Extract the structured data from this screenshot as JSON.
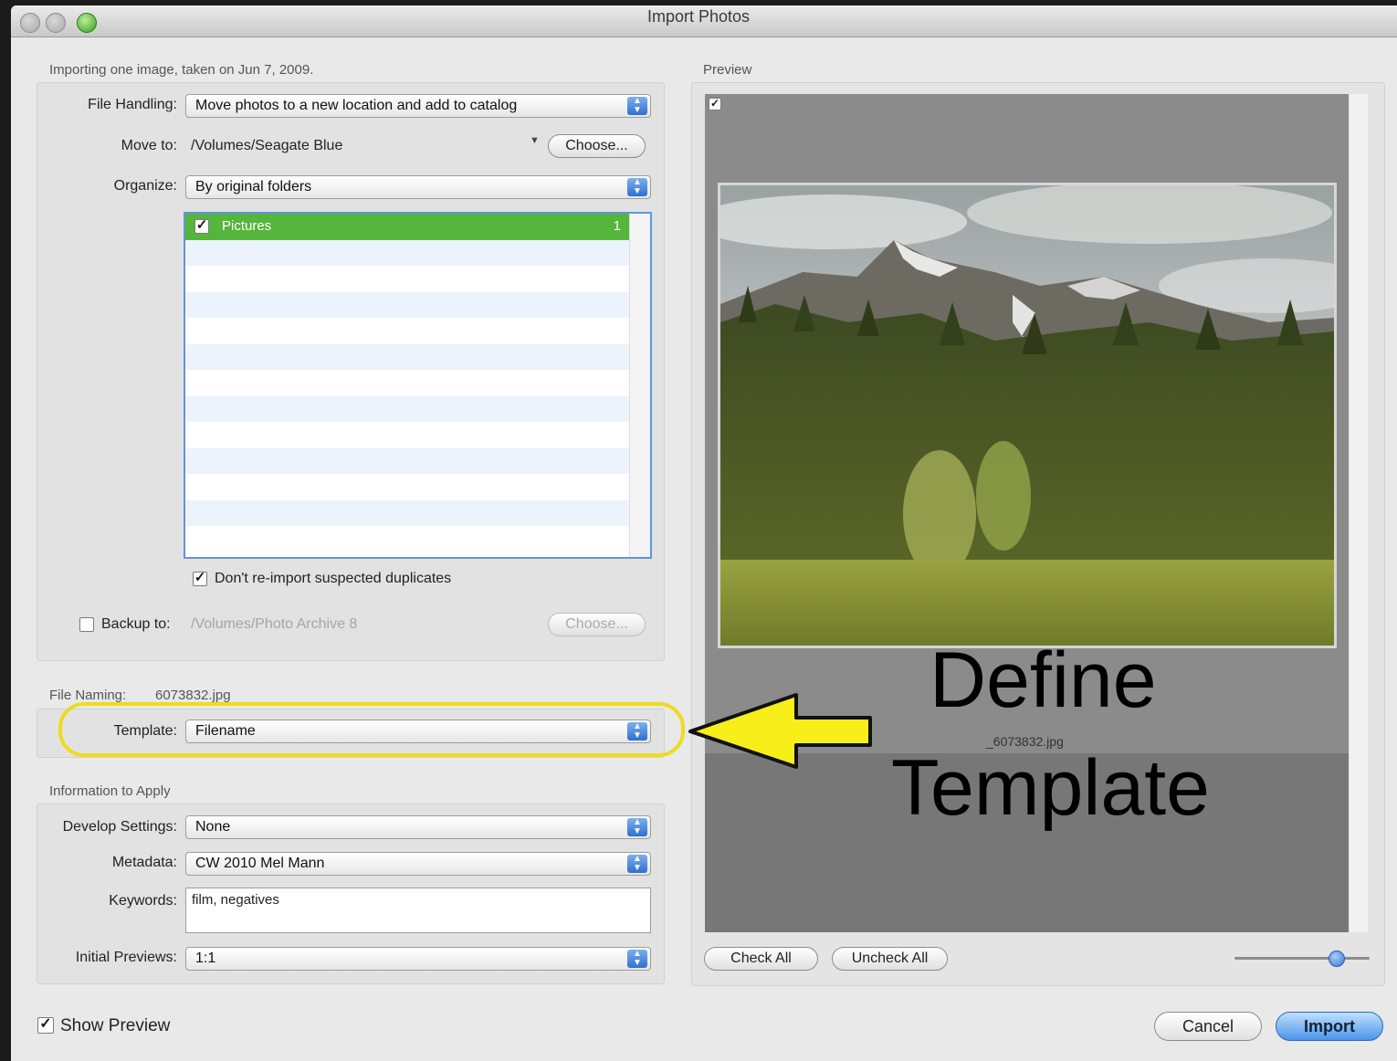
{
  "window": {
    "title": "Import Photos"
  },
  "summary": "Importing one image, taken on Jun 7, 2009.",
  "file_handling": {
    "label": "File Handling:",
    "value": "Move photos to a new location and add to catalog",
    "move_to_label": "Move to:",
    "move_to_path": "/Volumes/Seagate Blue",
    "choose_label": "Choose...",
    "organize_label": "Organize:",
    "organize_value": "By original folders",
    "folders": [
      {
        "name": "Pictures",
        "count": "1",
        "checked": true
      }
    ],
    "dont_reimport_label": "Don't re-import suspected duplicates",
    "backup_label": "Backup to:",
    "backup_path": "/Volumes/Photo Archive 8",
    "backup_choose_label": "Choose..."
  },
  "file_naming": {
    "label": "File Naming:",
    "example": "6073832.jpg",
    "template_label": "Template:",
    "template_value": "Filename"
  },
  "info": {
    "section_label": "Information to Apply",
    "develop_label": "Develop Settings:",
    "develop_value": "None",
    "metadata_label": "Metadata:",
    "metadata_value": "CW 2010 Mel Mann",
    "keywords_label": "Keywords:",
    "keywords_value": "film, negatives",
    "previews_label": "Initial Previews:",
    "previews_value": "1:1"
  },
  "preview": {
    "section_label": "Preview",
    "filename": "_6073832.jpg",
    "check_all": "Check All",
    "uncheck_all": "Uncheck All",
    "zoom_level": 0.75
  },
  "footer": {
    "show_preview_label": "Show Preview",
    "cancel_label": "Cancel",
    "import_label": "Import"
  },
  "annotation": {
    "line1": "Define",
    "line2": "Template",
    "arrow_color": "#f7ee1a",
    "highlight_color": "#ecdc1f"
  }
}
